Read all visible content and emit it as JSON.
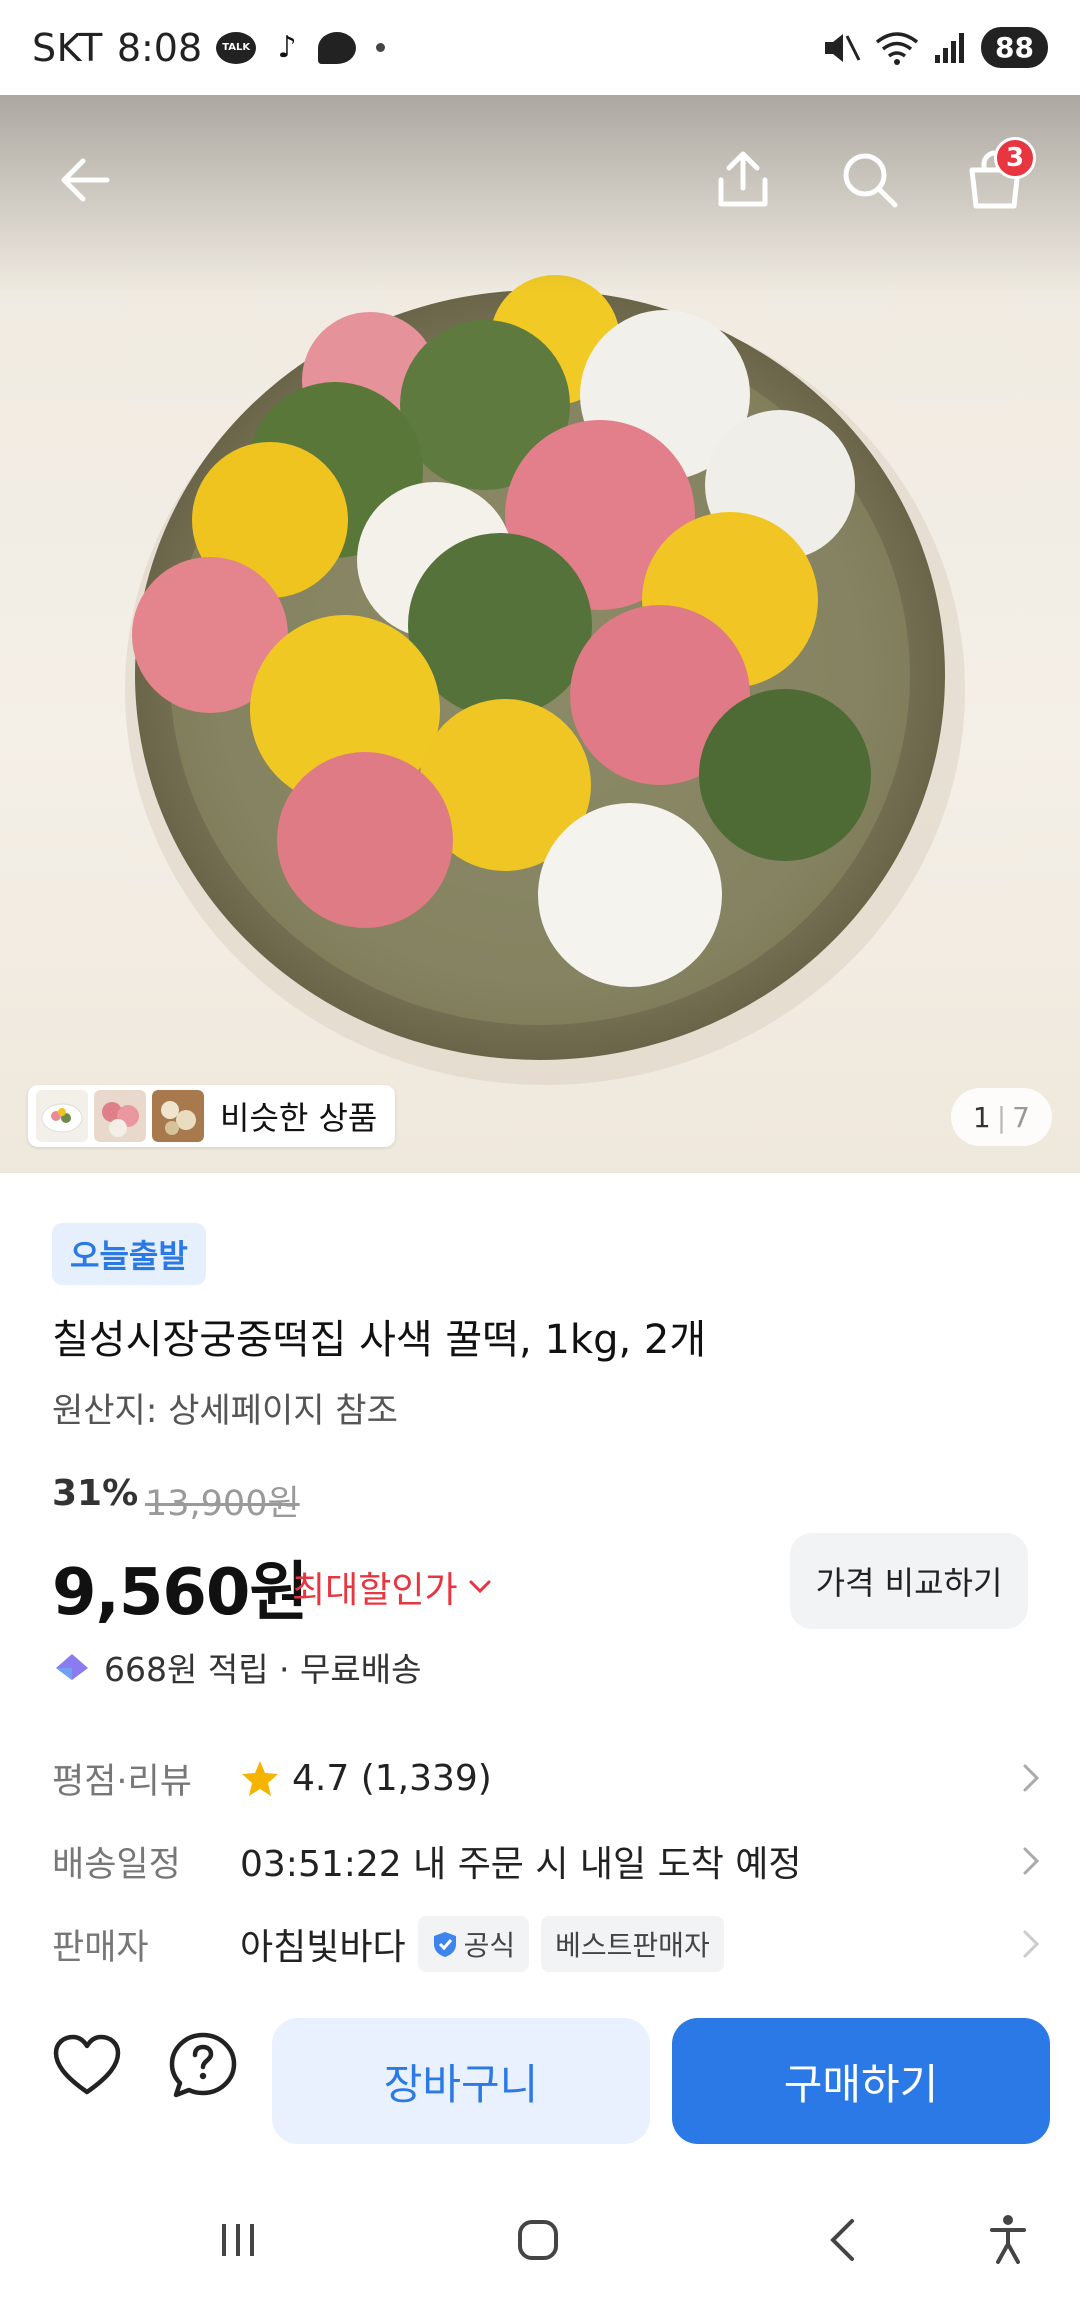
{
  "status_bar": {
    "carrier": "SKT",
    "time": "8:08",
    "talk_label": "TALK",
    "battery": "88"
  },
  "hero": {
    "cart_count": "3",
    "similar_label": "비슷한 상품",
    "page_current": "1",
    "page_total": "7"
  },
  "product": {
    "delivery_badge": "오늘출발",
    "title": "칠성시장궁중떡집 사색 꿀떡, 1kg, 2개",
    "origin": "원산지: 상세페이지 참조",
    "discount_rate": "31%",
    "original_price": "13,900원",
    "price": "9,560원",
    "max_discount_label": "최대할인가",
    "compare_button": "가격 비교하기",
    "points_text": "668원 적립 · 무료배송"
  },
  "info_rows": {
    "rating": {
      "label": "평점·리뷰",
      "value": "4.7 (1,339)"
    },
    "delivery": {
      "label": "배송일정",
      "value": "03:51:22 내 주문 시 내일 도착 예정"
    },
    "seller": {
      "label": "판매자",
      "value": "아침빛바다",
      "tag_official": "공식",
      "tag_best": "베스트판매자"
    }
  },
  "bottom_bar": {
    "cart_button": "장바구니",
    "buy_button": "구매하기"
  },
  "colors": {
    "accent_blue": "#2b79e6",
    "sale_red": "#e8353f",
    "star_yellow": "#f5b400"
  }
}
